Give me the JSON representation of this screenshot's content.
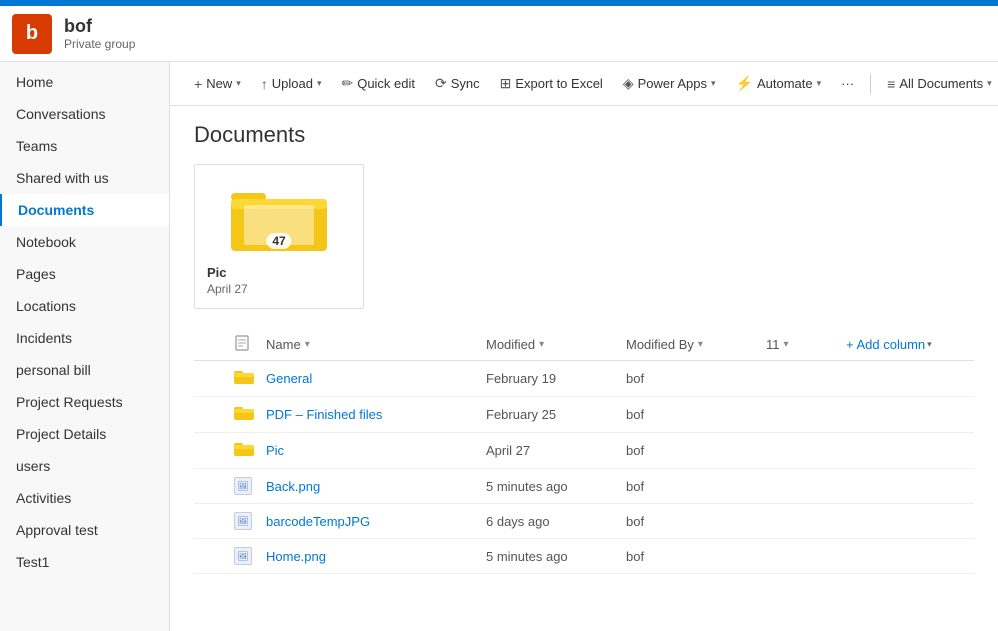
{
  "topbar": {
    "color": "#0078d4"
  },
  "header": {
    "icon_letter": "b",
    "icon_color": "#d83b01",
    "site_name": "bof",
    "site_sub": "Private group"
  },
  "sidebar": {
    "items": [
      {
        "id": "home",
        "label": "Home",
        "active": false
      },
      {
        "id": "conversations",
        "label": "Conversations",
        "active": false
      },
      {
        "id": "teams",
        "label": "Teams",
        "active": false
      },
      {
        "id": "shared-with-us",
        "label": "Shared with us",
        "active": false
      },
      {
        "id": "documents",
        "label": "Documents",
        "active": true
      },
      {
        "id": "notebook",
        "label": "Notebook",
        "active": false
      },
      {
        "id": "pages",
        "label": "Pages",
        "active": false
      },
      {
        "id": "locations",
        "label": "Locations",
        "active": false
      },
      {
        "id": "incidents",
        "label": "Incidents",
        "active": false
      },
      {
        "id": "personal-bill",
        "label": "personal bill",
        "active": false
      },
      {
        "id": "project-requests",
        "label": "Project Requests",
        "active": false
      },
      {
        "id": "project-details",
        "label": "Project Details",
        "active": false
      },
      {
        "id": "users",
        "label": "users",
        "active": false
      },
      {
        "id": "activities",
        "label": "Activities",
        "active": false
      },
      {
        "id": "approval-test",
        "label": "Approval test",
        "active": false
      },
      {
        "id": "test1",
        "label": "Test1",
        "active": false
      }
    ]
  },
  "toolbar": {
    "new_label": "New",
    "upload_label": "Upload",
    "quick_edit_label": "Quick edit",
    "sync_label": "Sync",
    "export_label": "Export to Excel",
    "power_apps_label": "Power Apps",
    "automate_label": "Automate",
    "more_label": "···",
    "all_docs_label": "All Documents"
  },
  "documents": {
    "title": "Documents",
    "folder_card": {
      "name": "Pic",
      "date": "April 27",
      "badge": "47"
    },
    "table": {
      "headers": {
        "name": "Name",
        "modified": "Modified",
        "modified_by": "Modified By",
        "col11": "11",
        "add_column": "+ Add column"
      },
      "rows": [
        {
          "type": "folder",
          "name": "General",
          "modified": "February 19",
          "modified_by": "bof"
        },
        {
          "type": "folder",
          "name": "PDF – Finished files",
          "modified": "February 25",
          "modified_by": "bof"
        },
        {
          "type": "folder",
          "name": "Pic",
          "modified": "April 27",
          "modified_by": "bof"
        },
        {
          "type": "image",
          "name": "Back.png",
          "modified": "5 minutes ago",
          "modified_by": "bof"
        },
        {
          "type": "image",
          "name": "barcodeTempJPG",
          "modified": "6 days ago",
          "modified_by": "bof"
        },
        {
          "type": "image",
          "name": "Home.png",
          "modified": "5 minutes ago",
          "modified_by": "bof"
        }
      ]
    }
  }
}
